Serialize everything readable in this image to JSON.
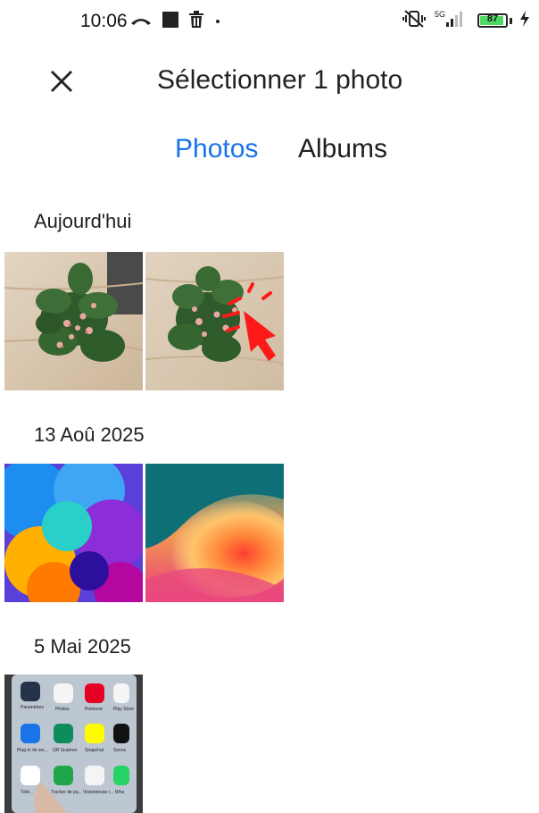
{
  "status_bar": {
    "time": "10:06",
    "battery": "87",
    "network": "5G",
    "icons": [
      "missed-call-icon",
      "stop-square-icon",
      "trash-icon",
      "dot-icon",
      "vibrate-off-icon",
      "signal-icon",
      "battery-icon",
      "charging-icon"
    ]
  },
  "header": {
    "title": "Sélectionner 1 photo",
    "close_icon": "close-icon"
  },
  "tabs": [
    {
      "label": "Photos",
      "active": true
    },
    {
      "label": "Albums",
      "active": false
    }
  ],
  "sections": [
    {
      "title": "Aujourd'hui",
      "photos": [
        {
          "name": "succulent plant on wood"
        },
        {
          "name": "succulent plant with cursor"
        }
      ]
    },
    {
      "title": "13 Aoû 2025",
      "photos": [
        {
          "name": "colorful abstract wallpaper"
        },
        {
          "name": "orange wave wallpaper"
        }
      ]
    },
    {
      "title": "5 Mai 2025",
      "photos": [
        {
          "name": "phone home screen"
        }
      ]
    }
  ],
  "phone_apps": [
    "Paramètres",
    "Photos",
    "Pinterest",
    "Play Store",
    "Plug-in de ser...",
    "QR Scanner",
    "Snapchat",
    "Sonos",
    "Télé...",
    "Tracker de pa...",
    "Visionneuse r...",
    "Wha"
  ],
  "colors": {
    "accent": "#1a73e8",
    "battery_fill": "#4cd964",
    "cursor": "#ff1a1a"
  }
}
